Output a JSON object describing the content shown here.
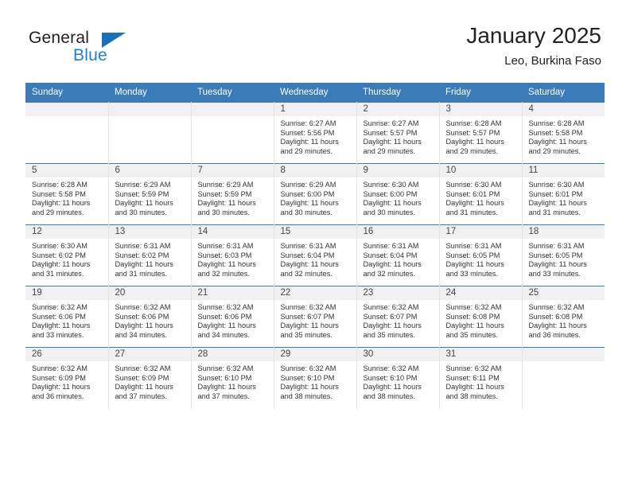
{
  "brand": {
    "name_top": "General",
    "name_bottom": "Blue",
    "accent_color": "#1c7fd6",
    "triangle_color": "#1c6fba"
  },
  "header": {
    "title": "January 2025",
    "subtitle": "Leo, Burkina Faso",
    "header_bg": "#3b7cb8",
    "daynum_band_bg": "#f0f0f0"
  },
  "weekdays": [
    "Sunday",
    "Monday",
    "Tuesday",
    "Wednesday",
    "Thursday",
    "Friday",
    "Saturday"
  ],
  "weeks": [
    [
      {
        "day": "",
        "sunrise": "",
        "sunset": "",
        "daylight_line1": "",
        "daylight_line2": ""
      },
      {
        "day": "",
        "sunrise": "",
        "sunset": "",
        "daylight_line1": "",
        "daylight_line2": ""
      },
      {
        "day": "",
        "sunrise": "",
        "sunset": "",
        "daylight_line1": "",
        "daylight_line2": ""
      },
      {
        "day": "1",
        "sunrise": "Sunrise: 6:27 AM",
        "sunset": "Sunset: 5:56 PM",
        "daylight_line1": "Daylight: 11 hours",
        "daylight_line2": "and 29 minutes."
      },
      {
        "day": "2",
        "sunrise": "Sunrise: 6:27 AM",
        "sunset": "Sunset: 5:57 PM",
        "daylight_line1": "Daylight: 11 hours",
        "daylight_line2": "and 29 minutes."
      },
      {
        "day": "3",
        "sunrise": "Sunrise: 6:28 AM",
        "sunset": "Sunset: 5:57 PM",
        "daylight_line1": "Daylight: 11 hours",
        "daylight_line2": "and 29 minutes."
      },
      {
        "day": "4",
        "sunrise": "Sunrise: 6:28 AM",
        "sunset": "Sunset: 5:58 PM",
        "daylight_line1": "Daylight: 11 hours",
        "daylight_line2": "and 29 minutes."
      }
    ],
    [
      {
        "day": "5",
        "sunrise": "Sunrise: 6:28 AM",
        "sunset": "Sunset: 5:58 PM",
        "daylight_line1": "Daylight: 11 hours",
        "daylight_line2": "and 29 minutes."
      },
      {
        "day": "6",
        "sunrise": "Sunrise: 6:29 AM",
        "sunset": "Sunset: 5:59 PM",
        "daylight_line1": "Daylight: 11 hours",
        "daylight_line2": "and 30 minutes."
      },
      {
        "day": "7",
        "sunrise": "Sunrise: 6:29 AM",
        "sunset": "Sunset: 5:59 PM",
        "daylight_line1": "Daylight: 11 hours",
        "daylight_line2": "and 30 minutes."
      },
      {
        "day": "8",
        "sunrise": "Sunrise: 6:29 AM",
        "sunset": "Sunset: 6:00 PM",
        "daylight_line1": "Daylight: 11 hours",
        "daylight_line2": "and 30 minutes."
      },
      {
        "day": "9",
        "sunrise": "Sunrise: 6:30 AM",
        "sunset": "Sunset: 6:00 PM",
        "daylight_line1": "Daylight: 11 hours",
        "daylight_line2": "and 30 minutes."
      },
      {
        "day": "10",
        "sunrise": "Sunrise: 6:30 AM",
        "sunset": "Sunset: 6:01 PM",
        "daylight_line1": "Daylight: 11 hours",
        "daylight_line2": "and 31 minutes."
      },
      {
        "day": "11",
        "sunrise": "Sunrise: 6:30 AM",
        "sunset": "Sunset: 6:01 PM",
        "daylight_line1": "Daylight: 11 hours",
        "daylight_line2": "and 31 minutes."
      }
    ],
    [
      {
        "day": "12",
        "sunrise": "Sunrise: 6:30 AM",
        "sunset": "Sunset: 6:02 PM",
        "daylight_line1": "Daylight: 11 hours",
        "daylight_line2": "and 31 minutes."
      },
      {
        "day": "13",
        "sunrise": "Sunrise: 6:31 AM",
        "sunset": "Sunset: 6:02 PM",
        "daylight_line1": "Daylight: 11 hours",
        "daylight_line2": "and 31 minutes."
      },
      {
        "day": "14",
        "sunrise": "Sunrise: 6:31 AM",
        "sunset": "Sunset: 6:03 PM",
        "daylight_line1": "Daylight: 11 hours",
        "daylight_line2": "and 32 minutes."
      },
      {
        "day": "15",
        "sunrise": "Sunrise: 6:31 AM",
        "sunset": "Sunset: 6:04 PM",
        "daylight_line1": "Daylight: 11 hours",
        "daylight_line2": "and 32 minutes."
      },
      {
        "day": "16",
        "sunrise": "Sunrise: 6:31 AM",
        "sunset": "Sunset: 6:04 PM",
        "daylight_line1": "Daylight: 11 hours",
        "daylight_line2": "and 32 minutes."
      },
      {
        "day": "17",
        "sunrise": "Sunrise: 6:31 AM",
        "sunset": "Sunset: 6:05 PM",
        "daylight_line1": "Daylight: 11 hours",
        "daylight_line2": "and 33 minutes."
      },
      {
        "day": "18",
        "sunrise": "Sunrise: 6:31 AM",
        "sunset": "Sunset: 6:05 PM",
        "daylight_line1": "Daylight: 11 hours",
        "daylight_line2": "and 33 minutes."
      }
    ],
    [
      {
        "day": "19",
        "sunrise": "Sunrise: 6:32 AM",
        "sunset": "Sunset: 6:06 PM",
        "daylight_line1": "Daylight: 11 hours",
        "daylight_line2": "and 33 minutes."
      },
      {
        "day": "20",
        "sunrise": "Sunrise: 6:32 AM",
        "sunset": "Sunset: 6:06 PM",
        "daylight_line1": "Daylight: 11 hours",
        "daylight_line2": "and 34 minutes."
      },
      {
        "day": "21",
        "sunrise": "Sunrise: 6:32 AM",
        "sunset": "Sunset: 6:06 PM",
        "daylight_line1": "Daylight: 11 hours",
        "daylight_line2": "and 34 minutes."
      },
      {
        "day": "22",
        "sunrise": "Sunrise: 6:32 AM",
        "sunset": "Sunset: 6:07 PM",
        "daylight_line1": "Daylight: 11 hours",
        "daylight_line2": "and 35 minutes."
      },
      {
        "day": "23",
        "sunrise": "Sunrise: 6:32 AM",
        "sunset": "Sunset: 6:07 PM",
        "daylight_line1": "Daylight: 11 hours",
        "daylight_line2": "and 35 minutes."
      },
      {
        "day": "24",
        "sunrise": "Sunrise: 6:32 AM",
        "sunset": "Sunset: 6:08 PM",
        "daylight_line1": "Daylight: 11 hours",
        "daylight_line2": "and 35 minutes."
      },
      {
        "day": "25",
        "sunrise": "Sunrise: 6:32 AM",
        "sunset": "Sunset: 6:08 PM",
        "daylight_line1": "Daylight: 11 hours",
        "daylight_line2": "and 36 minutes."
      }
    ],
    [
      {
        "day": "26",
        "sunrise": "Sunrise: 6:32 AM",
        "sunset": "Sunset: 6:09 PM",
        "daylight_line1": "Daylight: 11 hours",
        "daylight_line2": "and 36 minutes."
      },
      {
        "day": "27",
        "sunrise": "Sunrise: 6:32 AM",
        "sunset": "Sunset: 6:09 PM",
        "daylight_line1": "Daylight: 11 hours",
        "daylight_line2": "and 37 minutes."
      },
      {
        "day": "28",
        "sunrise": "Sunrise: 6:32 AM",
        "sunset": "Sunset: 6:10 PM",
        "daylight_line1": "Daylight: 11 hours",
        "daylight_line2": "and 37 minutes."
      },
      {
        "day": "29",
        "sunrise": "Sunrise: 6:32 AM",
        "sunset": "Sunset: 6:10 PM",
        "daylight_line1": "Daylight: 11 hours",
        "daylight_line2": "and 38 minutes."
      },
      {
        "day": "30",
        "sunrise": "Sunrise: 6:32 AM",
        "sunset": "Sunset: 6:10 PM",
        "daylight_line1": "Daylight: 11 hours",
        "daylight_line2": "and 38 minutes."
      },
      {
        "day": "31",
        "sunrise": "Sunrise: 6:32 AM",
        "sunset": "Sunset: 6:11 PM",
        "daylight_line1": "Daylight: 11 hours",
        "daylight_line2": "and 38 minutes."
      },
      {
        "day": "",
        "sunrise": "",
        "sunset": "",
        "daylight_line1": "",
        "daylight_line2": ""
      }
    ]
  ]
}
